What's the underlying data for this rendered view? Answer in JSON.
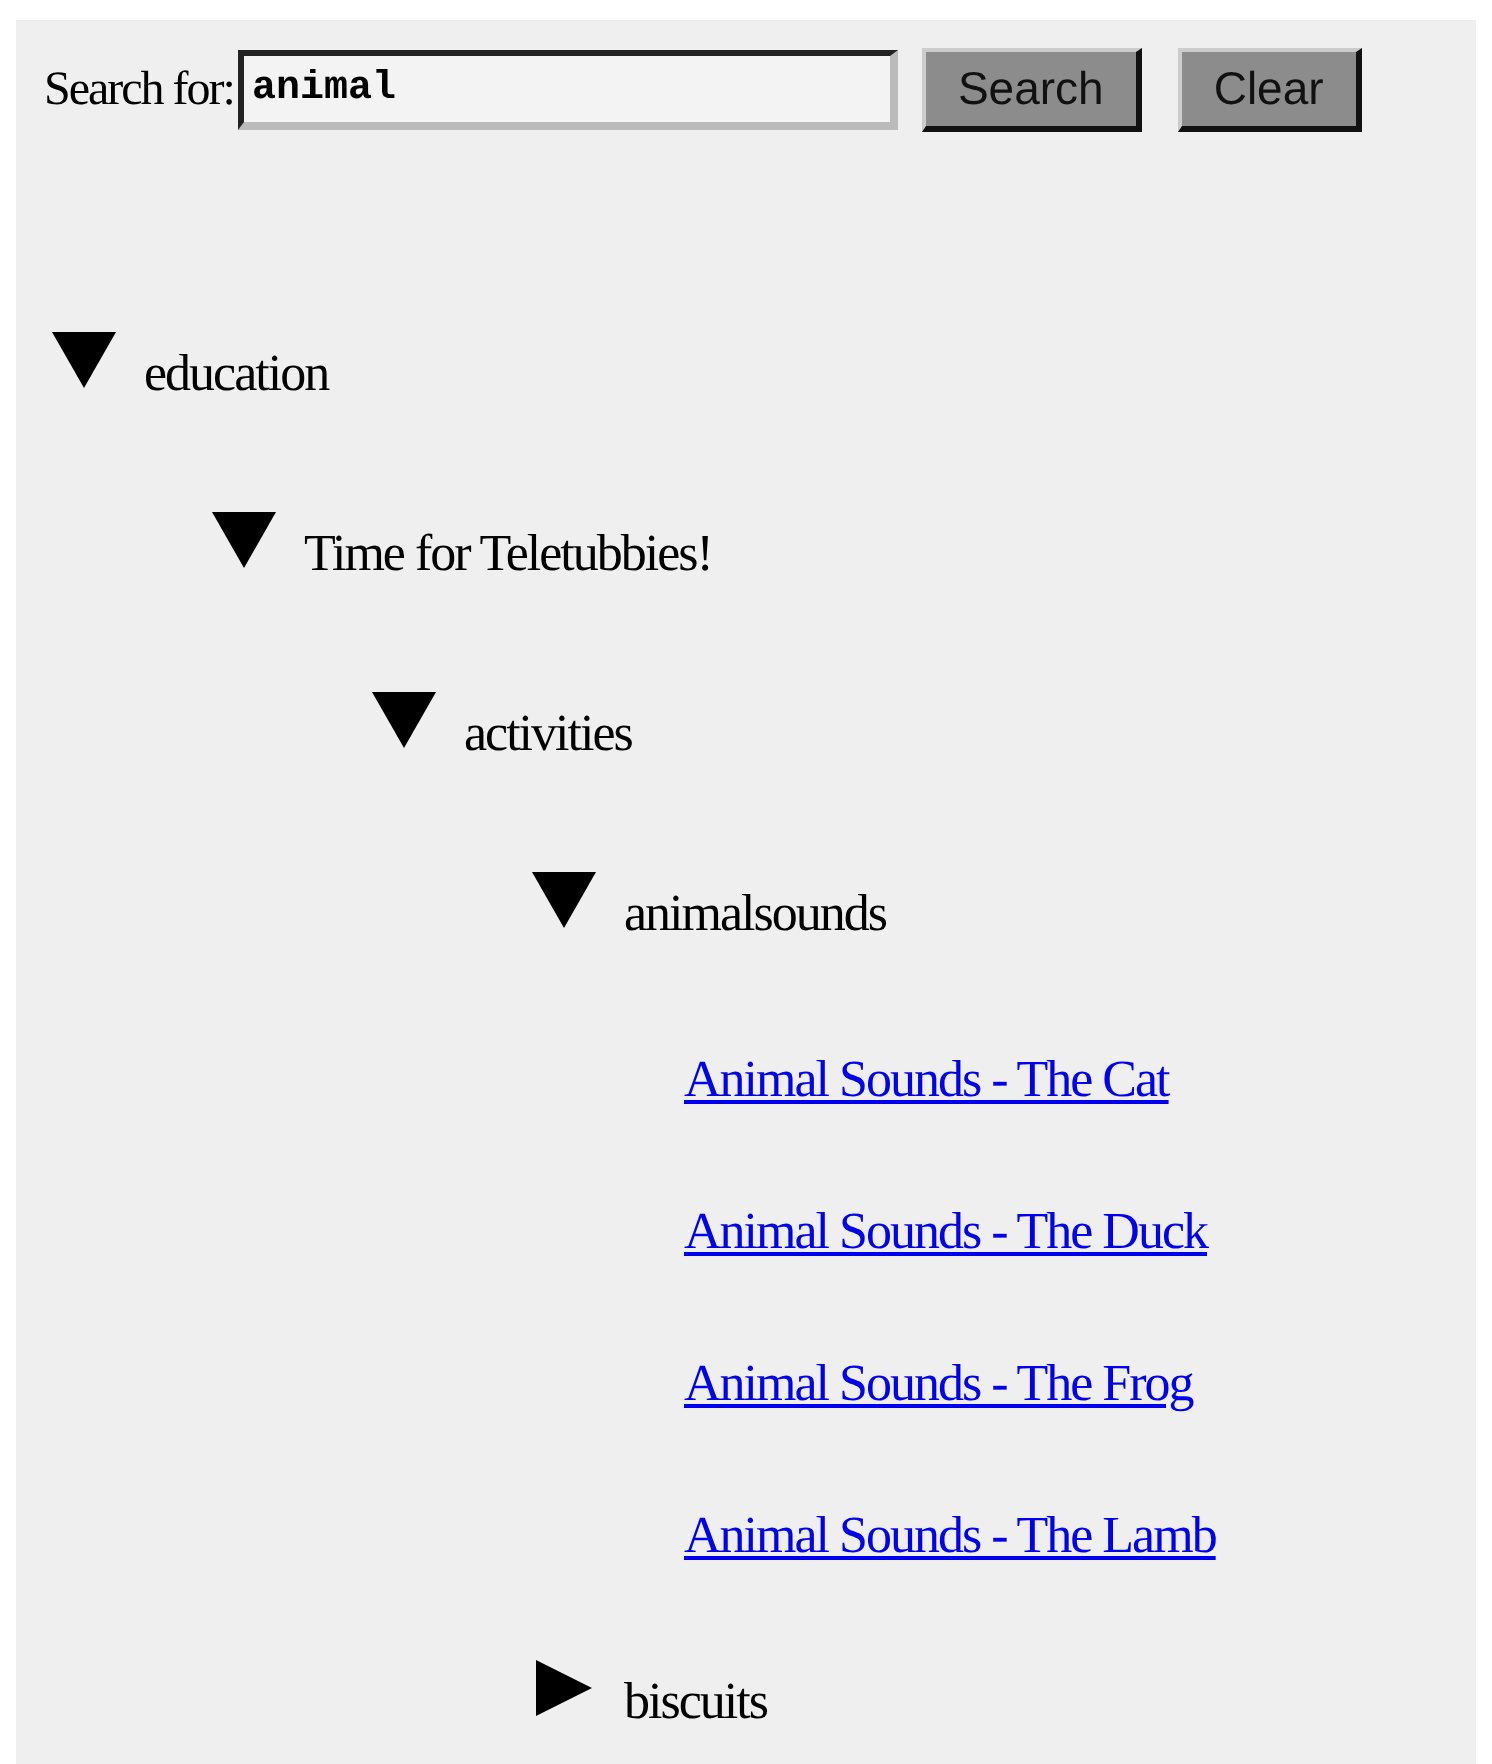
{
  "search": {
    "label": "Search for:",
    "value": "animal",
    "buttons": [
      "Search",
      "Clear"
    ]
  },
  "tree": [
    {
      "kind": "folder",
      "label": "education",
      "expanded": true,
      "children": [
        {
          "kind": "folder",
          "label": "Time for Teletubbies!",
          "expanded": true,
          "children": [
            {
              "kind": "folder",
              "label": "activities",
              "expanded": true,
              "children": [
                {
                  "kind": "folder",
                  "label": "animalsounds",
                  "expanded": true,
                  "children": [
                    {
                      "kind": "link",
                      "label": "Animal Sounds - The Cat"
                    },
                    {
                      "kind": "link",
                      "label": "Animal Sounds - The Duck"
                    },
                    {
                      "kind": "link",
                      "label": "Animal Sounds - The Frog"
                    },
                    {
                      "kind": "link",
                      "label": "Animal Sounds - The Lamb"
                    }
                  ]
                },
                {
                  "kind": "folder",
                  "label": "biscuits",
                  "expanded": false
                }
              ]
            }
          ]
        }
      ]
    }
  ]
}
